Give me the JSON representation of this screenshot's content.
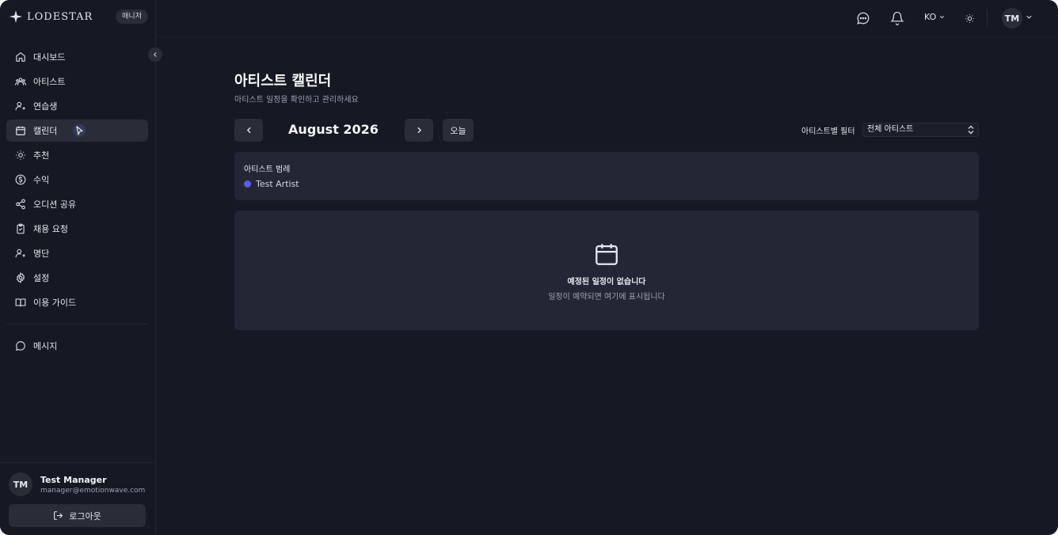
{
  "app": {
    "brand": "LODESTAR",
    "role_badge": "매니저"
  },
  "sidebar": {
    "items": [
      {
        "label": "대시보드",
        "icon": "home-icon"
      },
      {
        "label": "아티스트",
        "icon": "users-icon"
      },
      {
        "label": "연습생",
        "icon": "user-plus-icon"
      },
      {
        "label": "캘린더",
        "icon": "calendar-icon",
        "active": true
      },
      {
        "label": "추천",
        "icon": "lightbulb-icon"
      },
      {
        "label": "수익",
        "icon": "dollar-icon"
      },
      {
        "label": "오디션 공유",
        "icon": "share-icon"
      },
      {
        "label": "채용 요청",
        "icon": "clipboard-icon"
      },
      {
        "label": "명단",
        "icon": "user-plus-icon"
      },
      {
        "label": "설정",
        "icon": "gear-icon"
      },
      {
        "label": "이용 가이드",
        "icon": "book-icon"
      }
    ],
    "secondary_items": [
      {
        "label": "메시지",
        "icon": "message-icon"
      }
    ],
    "user": {
      "initials": "TM",
      "name": "Test Manager",
      "email": "manager@emotionwave.com"
    },
    "logout_label": "로그아웃"
  },
  "header": {
    "language": "KO",
    "avatar_initials": "TM"
  },
  "main": {
    "title": "아티스트 캘린더",
    "subtitle": "아티스트 일정을 확인하고 관리하세요",
    "month_label": "August 2026",
    "today_label": "오늘",
    "filter_label": "아티스트별 필터",
    "filter_value": "전체 아티스트",
    "legend": {
      "title": "아티스트 범례",
      "items": [
        {
          "name": "Test Artist",
          "color": "#5b5bf0"
        }
      ]
    },
    "empty": {
      "title": "예정된 일정이 없습니다",
      "subtitle": "일정이 예약되면 여기에 표시됩니다"
    }
  },
  "colors": {
    "background": "#161823",
    "card": "#242636",
    "accent": "#5b5bf0"
  }
}
